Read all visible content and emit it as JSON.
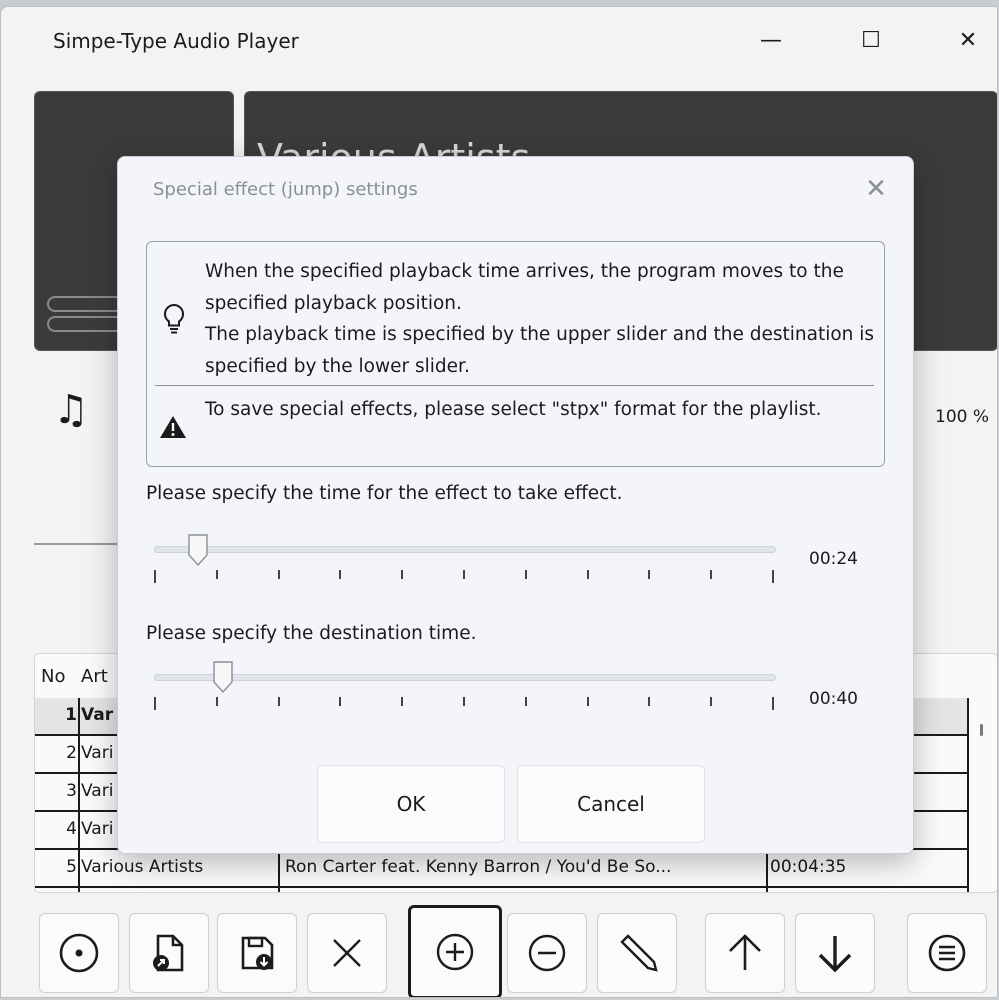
{
  "window": {
    "title": "Simpe-Type Audio Player",
    "minimize": "—",
    "maximize": "☐",
    "close": "✕",
    "artist_display": "Various Artists",
    "volume": "100 %"
  },
  "playlist": {
    "header": {
      "no": "No",
      "artist": "Art"
    },
    "rows": [
      {
        "no": "1",
        "artist": "Var",
        "title": "",
        "length": ""
      },
      {
        "no": "2",
        "artist": "Vari",
        "title": "",
        "length": ""
      },
      {
        "no": "3",
        "artist": "Vari",
        "title": "",
        "length": ""
      },
      {
        "no": "4",
        "artist": "Vari",
        "title": "",
        "length": ""
      },
      {
        "no": "5",
        "artist": "Various Artists",
        "title": "Ron Carter feat. Kenny Barron / You'd Be So...",
        "length": "00:04:35"
      }
    ]
  },
  "toolbar": {
    "buttons": [
      {
        "name": "disc-button",
        "icon": "disc-icon"
      },
      {
        "name": "open-file-button",
        "icon": "open-file-icon"
      },
      {
        "name": "save-button",
        "icon": "save-icon"
      },
      {
        "name": "delete-button",
        "icon": "close-icon"
      },
      {
        "name": "add-button",
        "icon": "plus-circle-icon"
      },
      {
        "name": "remove-button",
        "icon": "minus-circle-icon"
      },
      {
        "name": "edit-button",
        "icon": "pencil-icon"
      },
      {
        "name": "move-up-button",
        "icon": "arrow-up-icon"
      },
      {
        "name": "move-down-button",
        "icon": "arrow-down-icon"
      },
      {
        "name": "menu-button",
        "icon": "menu-circle-icon"
      }
    ]
  },
  "dialog": {
    "title": "Special effect (jump) settings",
    "close": "✕",
    "info_lines": [
      "When the specified playback time arrives, the program moves to the specified playback position.",
      "The playback time is specified by the upper slider and the destination is specified by the lower slider."
    ],
    "warning": "To save special effects, please select \"stpx\" format for the playlist.",
    "time_label": "Please specify the time for the effect to take effect.",
    "time_value": "00:24",
    "time_fraction": 0.06,
    "dest_label": "Please specify the destination time.",
    "dest_value": "00:40",
    "dest_fraction": 0.1,
    "ok_label": "OK",
    "cancel_label": "Cancel"
  },
  "colors": {
    "art_bg": "#3b3b3b",
    "dialog_bg": "#f3f5fa",
    "window_bg": "#f3f3f3"
  }
}
